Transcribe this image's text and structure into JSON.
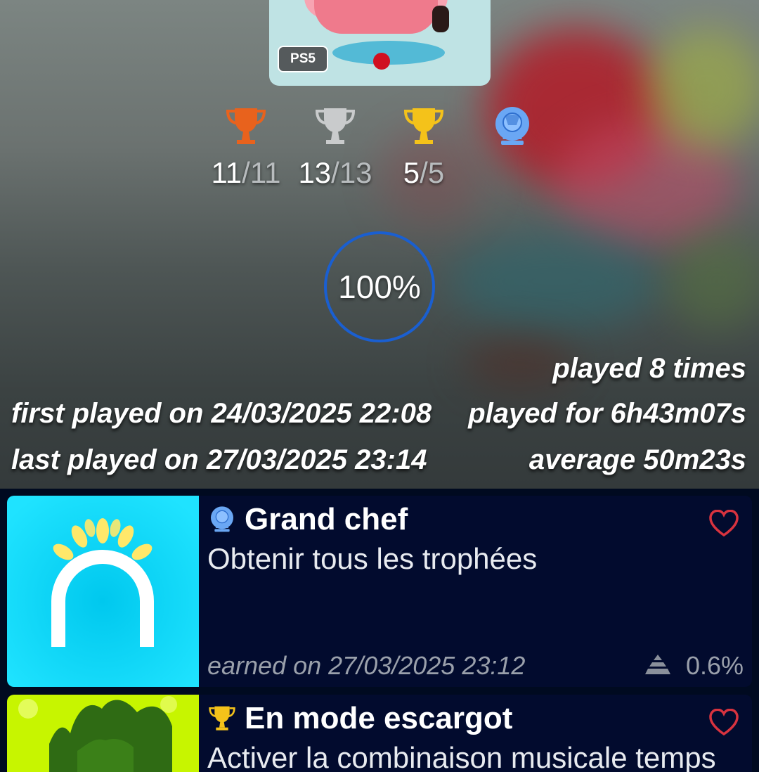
{
  "game": {
    "platform": "PS5",
    "trophies": [
      {
        "type": "bronze",
        "icon": "bronze-trophy-icon",
        "color": "#e8621d",
        "earned": "11",
        "total": "/11"
      },
      {
        "type": "silver",
        "icon": "silver-trophy-icon",
        "color": "#c9cbcc",
        "earned": "13",
        "total": "/13"
      },
      {
        "type": "gold",
        "icon": "gold-trophy-icon",
        "color": "#f4c21a",
        "earned": "5",
        "total": "/5"
      },
      {
        "type": "platinum",
        "icon": "platinum-trophy-icon",
        "color": "#6aa7f4"
      }
    ],
    "progress": {
      "value": 1.0,
      "label": "100%",
      "ring_color": "#1a5fd1"
    },
    "stats": {
      "played_times": "played 8 times",
      "first_played": "first played on 24/03/2025 22:08",
      "played_for": "played for 6h43m07s",
      "last_played": "last played on 27/03/2025 23:14",
      "average": "average 50m23s"
    }
  },
  "trophy_list": [
    {
      "type": "platinum",
      "icon": "platinum-trophy-icon",
      "title": "Grand chef",
      "description": "Obtenir tous les trophées",
      "earned": "earned on 27/03/2025 23:12",
      "rarity_icon": "rarity-pyramid-icon",
      "rarity": "0.6%",
      "favorite": false
    },
    {
      "type": "gold",
      "icon": "gold-trophy-icon",
      "title": "En mode escargot",
      "description": "Activer la combinaison musicale temps",
      "favorite": false
    }
  ],
  "colors": {
    "list_background": "#000a20",
    "card_background": "#020b2e",
    "favorite_heart": "#d8333f"
  }
}
